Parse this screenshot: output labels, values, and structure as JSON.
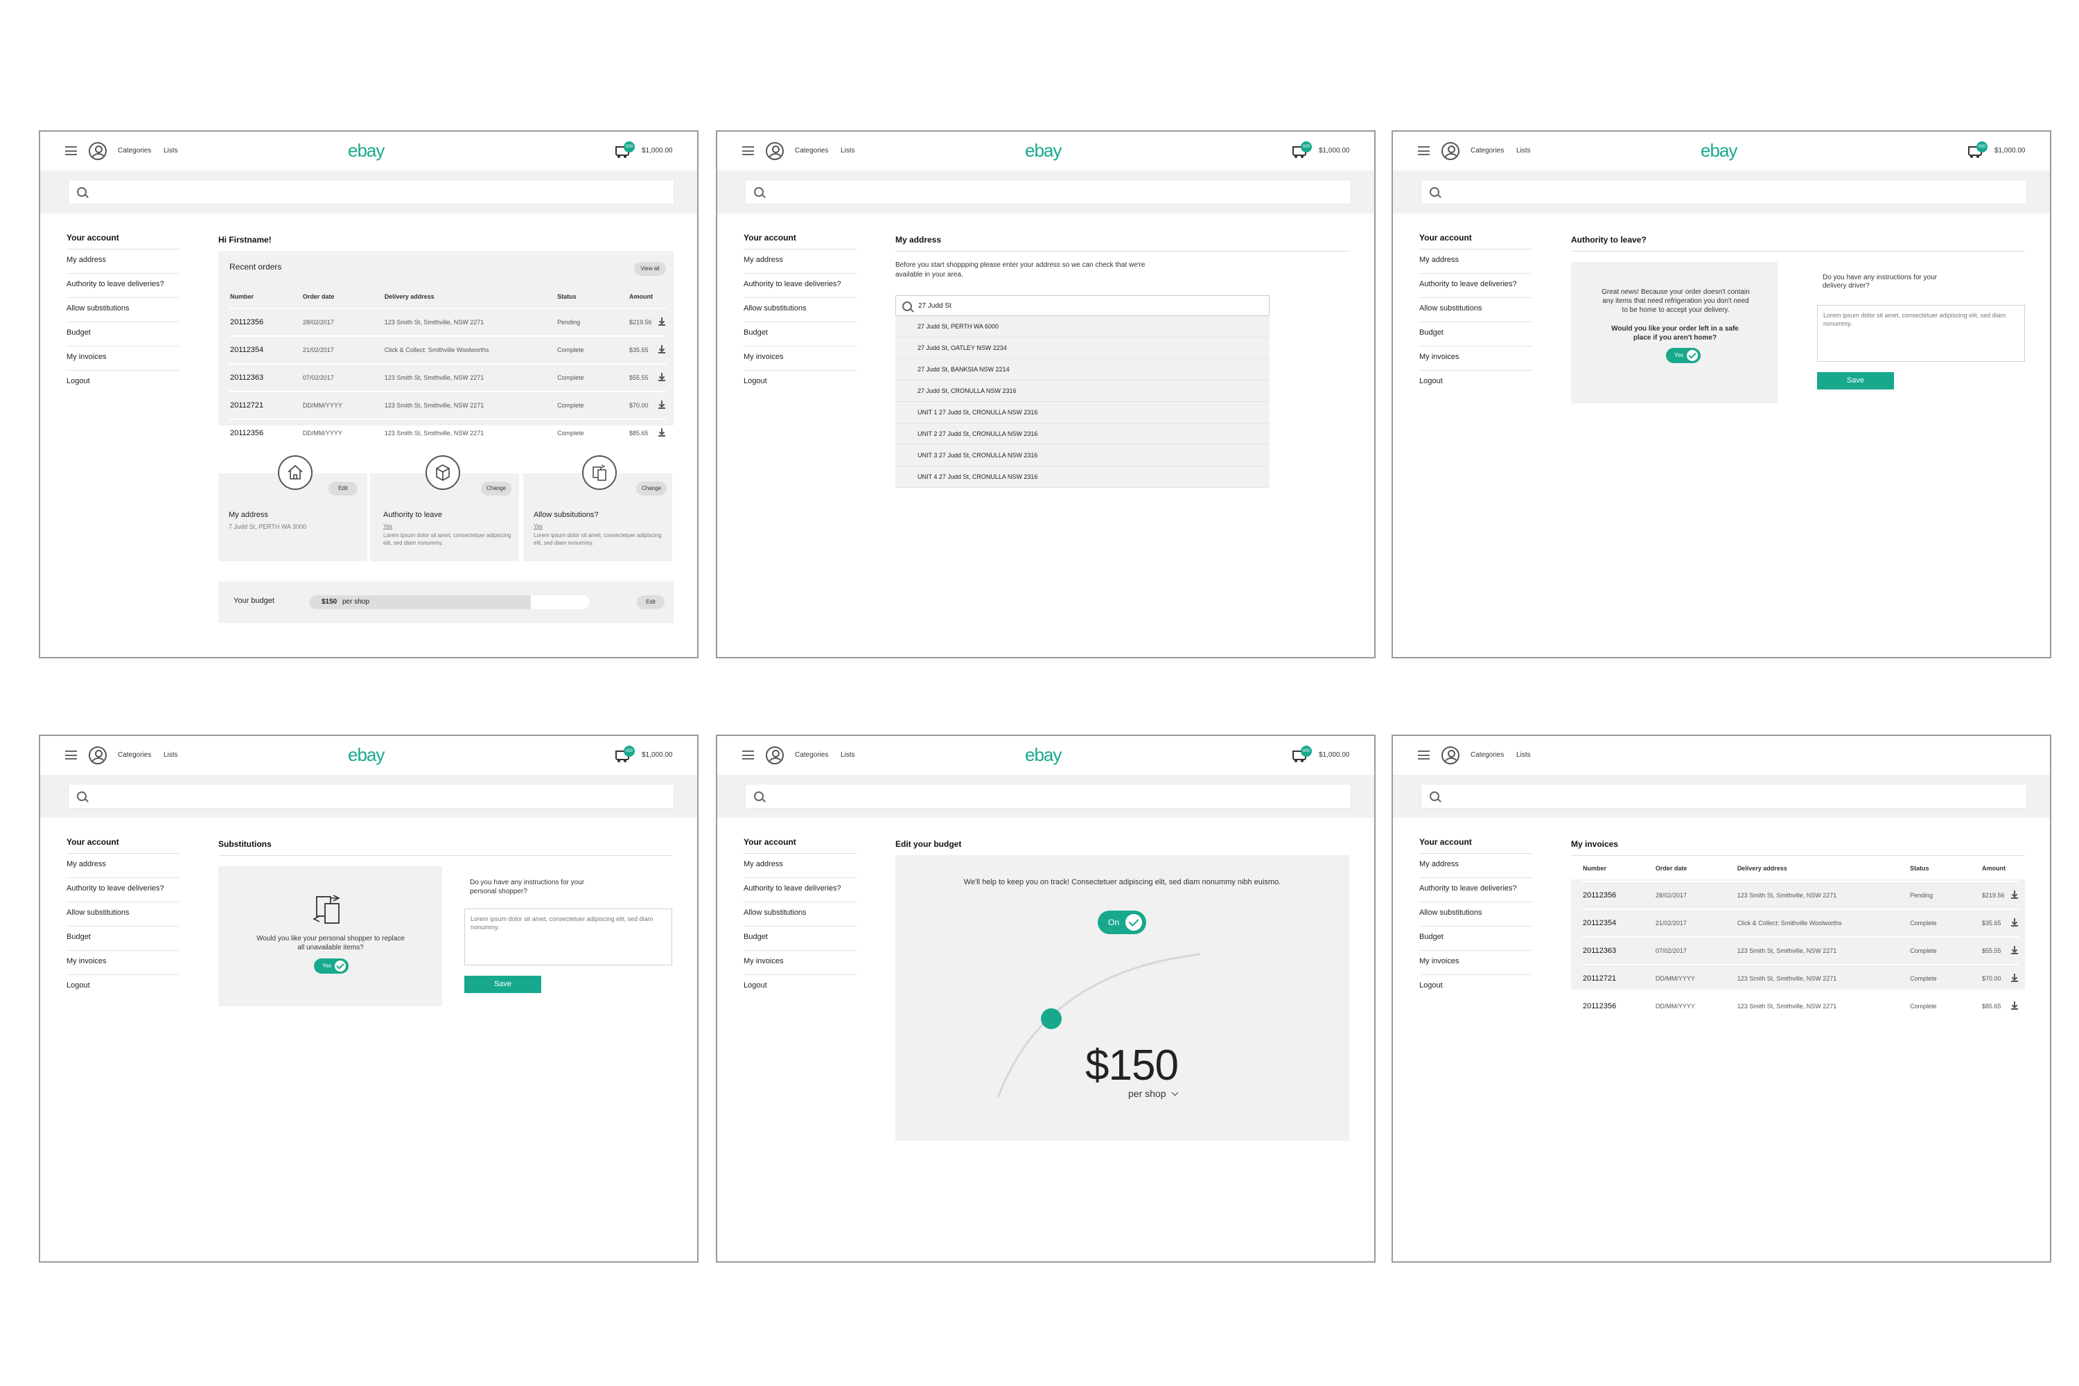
{
  "colors": {
    "accent": "#18a98d",
    "panel": "#f1f1f1",
    "frame_border": "#9a9a9a"
  },
  "header": {
    "nav_categories": "Categories",
    "nav_lists": "Lists",
    "logo": "ebay",
    "cart_count": "000",
    "cart_total": "$1,000.00"
  },
  "sidebar": {
    "title": "Your account",
    "items": [
      "My address",
      "Authority to leave deliveries?",
      "Allow substitutions",
      "Budget",
      "My invoices",
      "Logout"
    ]
  },
  "orders_table": {
    "headers": [
      "Number",
      "Order date",
      "Delivery address",
      "Status",
      "Amount"
    ],
    "rows": [
      [
        "20112356",
        "28/02/2017",
        "123 Smith St, Smithville, NSW 2271",
        "Pending",
        "$219.56"
      ],
      [
        "20112354",
        "21/02/2017",
        "Click & Collect: Smithville Woolworths",
        "Complete",
        "$35.65"
      ],
      [
        "20112363",
        "07/02/2017",
        "123 Smith St, Smithville, NSW 2271",
        "Complete",
        "$55.55"
      ],
      [
        "20112721",
        "DD/MM/YYYY",
        "123 Smith St, Smithville, NSW 2271",
        "Complete",
        "$70.00"
      ],
      [
        "20112356",
        "DD/MM/YYYY",
        "123 Smith St, Smithville, NSW 2271",
        "Complete",
        "$85.65"
      ]
    ]
  },
  "dashboard": {
    "greeting": "Hi Firstname!",
    "recent_orders": "Recent orders",
    "view_all": "View all",
    "cards": [
      {
        "icon": "house-icon",
        "button": "Edit",
        "title": "My address",
        "sub": "7 Judd St, PERTH WA 3000",
        "body": ""
      },
      {
        "icon": "box-icon",
        "button": "Change",
        "title": "Authority to leave",
        "sub": "Yes",
        "body": "Lorem ipsum dolor sit amet, consectetuer adipiscing elit, sed diam nonummy."
      },
      {
        "icon": "substitution-icon",
        "button": "Change",
        "title": "Allow subsitutions?",
        "sub": "Yes",
        "body": "Lorem ipsum dolor sit amet, consectetuer adipiscing elit, sed diam nonummy."
      }
    ],
    "budget_label": "Your budget",
    "budget_amount": "$150",
    "budget_unit": "per shop",
    "budget_fill": 0.79,
    "budget_edit": "Edit"
  },
  "address_page": {
    "title": "My address",
    "intro": "Before you start shoppping please enter your address so we can check that we're available in your area.",
    "search_value": "27 Judd St",
    "suggestions": [
      "27 Judd St, PERTH WA 6000",
      "27 Judd St, OATLEY NSW 2234",
      "27 Judd St, BANKSIA NSW 2214",
      "27 Judd St, CRONULLA NSW 2316",
      "UNIT 1 27 Judd St, CRONULLA NSW 2316",
      "UNIT 2 27 Judd St, CRONULLA NSW 2316",
      "UNIT 3 27 Judd St, CRONULLA NSW 2316",
      "UNIT 4 27 Judd St, CRONULLA NSW 2316"
    ]
  },
  "authority_page": {
    "title": "Authority to leave?",
    "message": "Great news! Because your order doesn't contain any items that need refrigeration you don't need to be home to accept your delivery.",
    "question": "Would you like your order left in a safe place if you aren't home?",
    "toggle": "Yes",
    "instructions_label": "Do you have any instructions for your delivery driver?",
    "instructions_text": "Lorem ipsum dolor sit amet, consectetuer adipiscing elit, sed diam nonummy.",
    "save": "Save"
  },
  "substitutions_page": {
    "title": "Substitutions",
    "question": "Would you like your personal shopper to replace all unavailable items?",
    "toggle": "Yes",
    "instructions_label": "Do you have any instructions for your personal shopper?",
    "instructions_text": "Lorem ipsum dolor sit amet, consectetuer adipiscing elit, sed diam nonummy.",
    "save": "Save"
  },
  "budget_page": {
    "title": "Edit your budget",
    "message": "We'll help to keep you on track! Consectetuer adipiscing elit, sed diam nonummy nibh euismo.",
    "toggle": "On",
    "amount": "$150",
    "unit": "per shop"
  },
  "invoices_page": {
    "title": "My invoices"
  }
}
